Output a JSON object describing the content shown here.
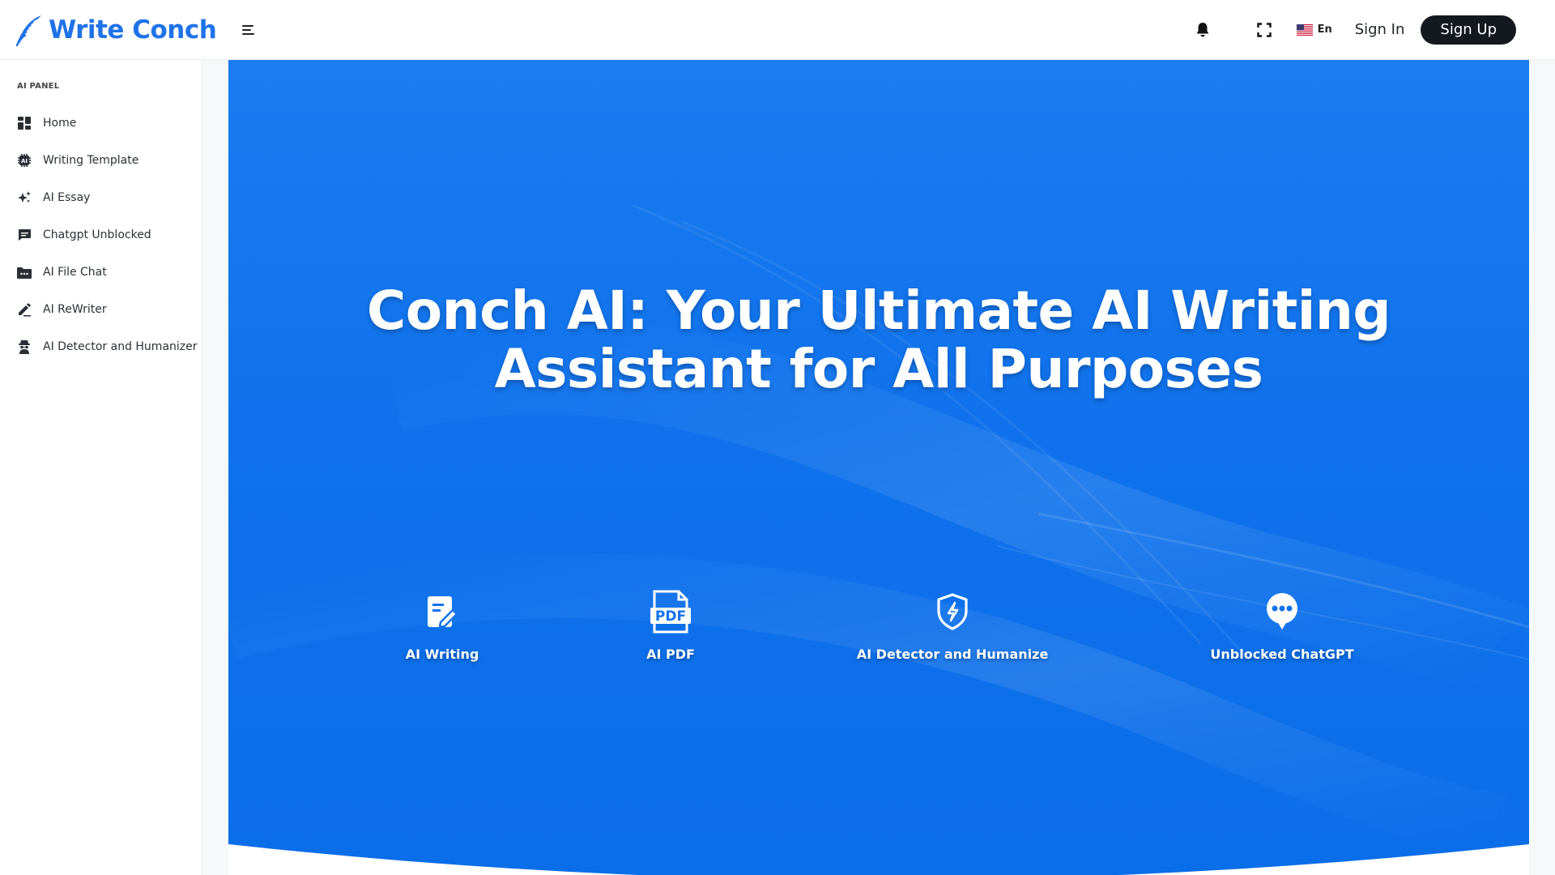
{
  "brand": {
    "name": "Write Conch",
    "accent": "#1f73e8"
  },
  "header": {
    "notification_icon": "bell-icon",
    "fullscreen_icon": "fullscreen-icon",
    "language": {
      "flag": "us-flag-icon",
      "label": "En"
    },
    "signin_label": "Sign In",
    "signup_label": "Sign Up"
  },
  "sidebar": {
    "panel_title": "AI PANEL",
    "items": [
      {
        "label": "Home",
        "icon": "dashboard-icon"
      },
      {
        "label": "Writing Template",
        "icon": "ai-chip-icon"
      },
      {
        "label": "AI Essay",
        "icon": "sparkle-icon"
      },
      {
        "label": "Chatgpt Unblocked",
        "icon": "chat-icon"
      },
      {
        "label": "AI File Chat",
        "icon": "folder-icon"
      },
      {
        "label": "AI ReWriter",
        "icon": "pencil-icon"
      },
      {
        "label": "AI Detector and Humanizer",
        "icon": "detective-icon"
      }
    ]
  },
  "hero": {
    "title_line1": "Conch AI: Your Ultimate AI Writing",
    "title_line2": "Assistant for All Purposes",
    "features": [
      {
        "label": "AI Writing",
        "icon": "document-edit-icon"
      },
      {
        "label": "AI PDF",
        "icon": "pdf-icon"
      },
      {
        "label": "AI Detector and Humanize",
        "icon": "shield-bolt-icon"
      },
      {
        "label": "Unblocked ChatGPT",
        "icon": "chat-bubble-icon"
      }
    ],
    "pdf_icon_text": "PDF",
    "background_color": "#0f72ec"
  }
}
